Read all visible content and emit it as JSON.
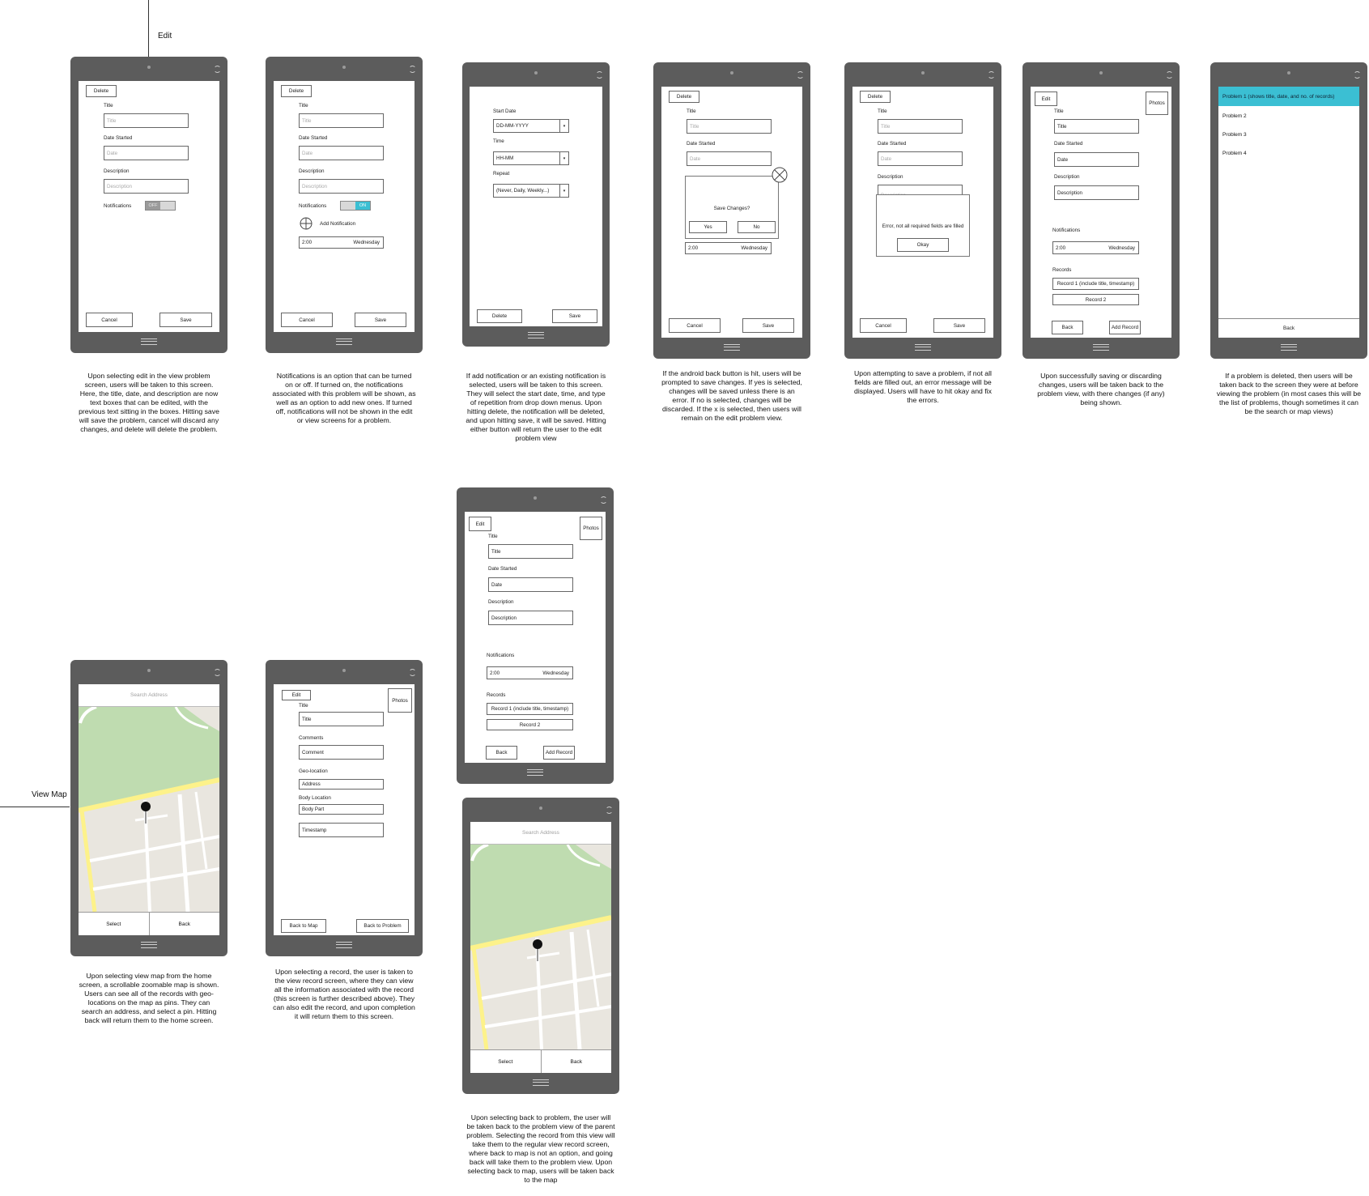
{
  "annotations": {
    "edit": "Edit",
    "view_map": "View Map"
  },
  "labels": {
    "delete": "Delete",
    "title": "Title",
    "date_started": "Date Started",
    "description": "Description",
    "notifications": "Notifications",
    "off": "OFF",
    "on": "ON",
    "cancel": "Cancel",
    "save": "Save",
    "ph_title": "Title",
    "ph_date": "Date",
    "ph_description": "Description",
    "add_notification": "Add Notification",
    "time_value": "2:00",
    "day_value": "Wednesday",
    "start_date": "Start Date",
    "date_format": "DD-MM-YYYY",
    "time": "Time",
    "time_format": "HH-MM",
    "repeat": "Repeat",
    "repeat_options": "(Never, Daily, Weekly...)",
    "save_changes": "Save Changes?",
    "yes": "Yes",
    "no": "No",
    "error_msg": "Error, not all required fields are filled",
    "okay": "Okay",
    "edit": "Edit",
    "photos": "Photos",
    "records": "Records",
    "record1": "Record 1 (include title, timestamp)",
    "record2": "Record 2",
    "back": "Back",
    "add_record": "Add Record",
    "search_address": "Search Address",
    "select": "Select",
    "comments": "Comments",
    "comment": "Comment",
    "geo_location": "Geo-location",
    "address": "Address",
    "body_location": "Body Location",
    "body_part": "Body Part",
    "timestamp": "Timestamp",
    "back_to_map": "Back to Map",
    "back_to_problem": "Back to Problem",
    "desc_cut": "Description"
  },
  "problem_list": [
    "Problem 1 (shows title, date, and no. of records)",
    "Problem 2",
    "Problem 3",
    "Problem 4"
  ],
  "captions": {
    "c1": "Upon selecting edit in the view problem screen, users will be taken to this screen. Here, the title, date, and description are now text boxes that can be edited, with the previous text sitting in the boxes. Hitting save will save the problem, cancel will discard any changes, and delete will delete the problem.",
    "c2": "Notifications is an option that can be turned on or off. If turned on, the notifications associated with this problem will be shown, as well as an option to add new ones. If turned off, notifications will not be shown in the edit or view screens for a problem.",
    "c3": "If add notification or an existing notification is selected, users will be taken to this screen. They will select the start date, time, and type of repetition from drop down menus. Upon hitting delete, the notification will be deleted, and upon hitting save, it will be saved. Hitting either button will return the user to the edit problem view",
    "c4": "If the android back button is hit, users will be prompted to save changes. If yes is selected, changes will be saved unless there is an error. If no is selected, changes will be discarded. If the x is selected, then users will remain on the edit problem view.",
    "c5": "Upon attempting to save a problem, if not all fields are filled out, an error message will be displayed. Users will have to hit okay and fix the errors.",
    "c6": "Upon successfully saving or discarding changes, users will be taken back to the problem view, with there changes (if any) being shown.",
    "c7": "If a problem is deleted, then users will be taken back to the screen they were at before viewing the problem (in most cases this will be the list of problems, though sometimes it can be the search or map views)",
    "c8": "Upon selecting view map from the home screen, a scrollable zoomable map is shown. Users can see all of the records with geo-locations on the map as pins. They can search an address, and select a pin. Hitting back will return them to the home screen.",
    "c9": "Upon selecting a record, the user is taken to the view record screen, where they can view all the information associated with the record (this screen is further described above). They can also edit the record, and upon completion it will return them to this screen.",
    "c10": "Upon selecting back to problem, the user will be taken back to the problem view of the parent problem. Selecting the record from this view will take them to the regular view record screen, where back to map is not an option, and going back will take them to the problem view. Upon selecting back to map, users will be taken back to the map"
  },
  "colors": {
    "phone": "#5c5c5c",
    "accent": "#3bbfd3",
    "map_green": "#bfdcb0",
    "map_road": "#fdf28a",
    "map_bg": "#e9e6df"
  }
}
